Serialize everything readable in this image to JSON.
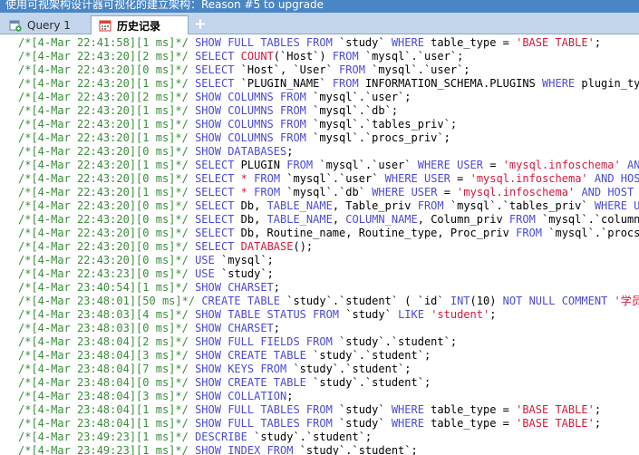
{
  "window": {
    "title": "使用可视架构设计器可视化的建立架构：Reason #5 to upgrade"
  },
  "tabs": [
    {
      "label": "Query 1",
      "active": false
    },
    {
      "label": "历史记录",
      "active": true
    }
  ],
  "add_tab_label": "+",
  "colors": {
    "comment": "#3a8d3a",
    "keyword": "#4b4bd6",
    "string": "#d5193a",
    "tabbar": "#c2d5ea",
    "titlebar": "#4a86c5"
  },
  "history": [
    [
      [
        "c",
        "/*[4-Mar 22:41:58][1 ms]*/"
      ],
      [
        "t",
        " "
      ],
      [
        "k",
        "SHOW FULL TABLES FROM"
      ],
      [
        "t",
        " `study` "
      ],
      [
        "k",
        "WHERE"
      ],
      [
        "t",
        " table_type = "
      ],
      [
        "s",
        "'BASE TABLE'"
      ],
      [
        "t",
        ";"
      ]
    ],
    [
      [
        "c",
        "/*[4-Mar 22:43:20][2 ms]*/"
      ],
      [
        "t",
        " "
      ],
      [
        "k",
        "SELECT"
      ],
      [
        "t",
        " "
      ],
      [
        "f",
        "COUNT"
      ],
      [
        "t",
        "(`Host`) "
      ],
      [
        "k",
        "FROM"
      ],
      [
        "t",
        " `mysql`.`user`;"
      ]
    ],
    [
      [
        "c",
        "/*[4-Mar 22:43:20][0 ms]*/"
      ],
      [
        "t",
        " "
      ],
      [
        "k",
        "SELECT"
      ],
      [
        "t",
        " `Host`, `User` "
      ],
      [
        "k",
        "FROM"
      ],
      [
        "t",
        " `mysql`.`user`;"
      ]
    ],
    [
      [
        "c",
        "/*[4-Mar 22:43:20][1 ms]*/"
      ],
      [
        "t",
        " "
      ],
      [
        "k",
        "SELECT"
      ],
      [
        "t",
        " `PLUGIN_NAME` "
      ],
      [
        "k",
        "FROM"
      ],
      [
        "t",
        " INFORMATION_SCHEMA.PLUGINS "
      ],
      [
        "k",
        "WHERE"
      ],
      [
        "t",
        " plugin_type="
      ]
    ],
    [
      [
        "c",
        "/*[4-Mar 22:43:20][2 ms]*/"
      ],
      [
        "t",
        " "
      ],
      [
        "k",
        "SHOW COLUMNS FROM"
      ],
      [
        "t",
        " `mysql`.`user`;"
      ]
    ],
    [
      [
        "c",
        "/*[4-Mar 22:43:20][1 ms]*/"
      ],
      [
        "t",
        " "
      ],
      [
        "k",
        "SHOW COLUMNS FROM"
      ],
      [
        "t",
        " `mysql`.`db`;"
      ]
    ],
    [
      [
        "c",
        "/*[4-Mar 22:43:20][1 ms]*/"
      ],
      [
        "t",
        " "
      ],
      [
        "k",
        "SHOW COLUMNS FROM"
      ],
      [
        "t",
        " `mysql`.`tables_priv`;"
      ]
    ],
    [
      [
        "c",
        "/*[4-Mar 22:43:20][1 ms]*/"
      ],
      [
        "t",
        " "
      ],
      [
        "k",
        "SHOW COLUMNS FROM"
      ],
      [
        "t",
        " `mysql`.`procs_priv`;"
      ]
    ],
    [
      [
        "c",
        "/*[4-Mar 22:43:20][0 ms]*/"
      ],
      [
        "t",
        " "
      ],
      [
        "k",
        "SHOW DATABASES"
      ],
      [
        "t",
        ";"
      ]
    ],
    [
      [
        "c",
        "/*[4-Mar 22:43:20][1 ms]*/"
      ],
      [
        "t",
        " "
      ],
      [
        "k",
        "SELECT"
      ],
      [
        "t",
        " PLUGIN "
      ],
      [
        "k",
        "FROM"
      ],
      [
        "t",
        " `mysql`.`user` "
      ],
      [
        "k",
        "WHERE"
      ],
      [
        "t",
        " "
      ],
      [
        "k",
        "USER"
      ],
      [
        "t",
        " = "
      ],
      [
        "s",
        "'mysql.infoschema'"
      ],
      [
        "t",
        " "
      ],
      [
        "k",
        "AND H"
      ]
    ],
    [
      [
        "c",
        "/*[4-Mar 22:43:20][0 ms]*/"
      ],
      [
        "t",
        " "
      ],
      [
        "k",
        "SELECT"
      ],
      [
        "t",
        " "
      ],
      [
        "s",
        "*"
      ],
      [
        "t",
        " "
      ],
      [
        "k",
        "FROM"
      ],
      [
        "t",
        " `mysql`.`user` "
      ],
      [
        "k",
        "WHERE"
      ],
      [
        "t",
        " "
      ],
      [
        "k",
        "USER"
      ],
      [
        "t",
        " = "
      ],
      [
        "s",
        "'mysql.infoschema'"
      ],
      [
        "t",
        " "
      ],
      [
        "k",
        "AND HOST"
      ],
      [
        "t",
        " ="
      ]
    ],
    [
      [
        "c",
        "/*[4-Mar 22:43:20][1 ms]*/"
      ],
      [
        "t",
        " "
      ],
      [
        "k",
        "SELECT"
      ],
      [
        "t",
        " "
      ],
      [
        "s",
        "*"
      ],
      [
        "t",
        " "
      ],
      [
        "k",
        "FROM"
      ],
      [
        "t",
        " `mysql`.`db` "
      ],
      [
        "k",
        "WHERE"
      ],
      [
        "t",
        " "
      ],
      [
        "k",
        "USER"
      ],
      [
        "t",
        " = "
      ],
      [
        "s",
        "'mysql.infoschema'"
      ],
      [
        "t",
        " "
      ],
      [
        "k",
        "AND HOST"
      ],
      [
        "t",
        " = "
      ],
      [
        "s",
        "'"
      ]
    ],
    [
      [
        "c",
        "/*[4-Mar 22:43:20][0 ms]*/"
      ],
      [
        "t",
        " "
      ],
      [
        "k",
        "SELECT"
      ],
      [
        "t",
        " Db, "
      ],
      [
        "k",
        "TABLE_NAME"
      ],
      [
        "t",
        ", Table_priv "
      ],
      [
        "k",
        "FROM"
      ],
      [
        "t",
        " `mysql`.`tables_priv` "
      ],
      [
        "k",
        "WHERE USER"
      ]
    ],
    [
      [
        "c",
        "/*[4-Mar 22:43:20][0 ms]*/"
      ],
      [
        "t",
        " "
      ],
      [
        "k",
        "SELECT"
      ],
      [
        "t",
        " Db, "
      ],
      [
        "k",
        "TABLE_NAME"
      ],
      [
        "t",
        ", "
      ],
      [
        "k",
        "COLUMN_NAME"
      ],
      [
        "t",
        ", Column_priv "
      ],
      [
        "k",
        "FROM"
      ],
      [
        "t",
        " `mysql`.`columns_p"
      ]
    ],
    [
      [
        "c",
        "/*[4-Mar 22:43:20][0 ms]*/"
      ],
      [
        "t",
        " "
      ],
      [
        "k",
        "SELECT"
      ],
      [
        "t",
        " Db, Routine_name, Routine_type, Proc_priv "
      ],
      [
        "k",
        "FROM"
      ],
      [
        "t",
        " `mysql`.`procs_p"
      ]
    ],
    [
      [
        "c",
        "/*[4-Mar 22:43:20][0 ms]*/"
      ],
      [
        "t",
        " "
      ],
      [
        "k",
        "SELECT"
      ],
      [
        "t",
        " "
      ],
      [
        "f",
        "DATABASE"
      ],
      [
        "t",
        "();"
      ]
    ],
    [
      [
        "c",
        "/*[4-Mar 22:43:20][0 ms]*/"
      ],
      [
        "t",
        " "
      ],
      [
        "k",
        "USE"
      ],
      [
        "t",
        " `mysql`;"
      ]
    ],
    [
      [
        "c",
        "/*[4-Mar 22:43:23][0 ms]*/"
      ],
      [
        "t",
        " "
      ],
      [
        "k",
        "USE"
      ],
      [
        "t",
        " `study`;"
      ]
    ],
    [
      [
        "c",
        "/*[4-Mar 23:40:54][1 ms]*/"
      ],
      [
        "t",
        " "
      ],
      [
        "k",
        "SHOW CHARSET"
      ],
      [
        "t",
        ";"
      ]
    ],
    [
      [
        "c",
        "/*[4-Mar 23:48:01][50 ms]*/"
      ],
      [
        "t",
        " "
      ],
      [
        "k",
        "CREATE TABLE"
      ],
      [
        "t",
        " `study`.`student` ( `id` "
      ],
      [
        "k",
        "INT"
      ],
      [
        "t",
        "(10) "
      ],
      [
        "k",
        "NOT NULL COMMENT"
      ],
      [
        "t",
        " "
      ],
      [
        "s",
        "'学员id"
      ]
    ],
    [
      [
        "c",
        "/*[4-Mar 23:48:03][4 ms]*/"
      ],
      [
        "t",
        " "
      ],
      [
        "k",
        "SHOW TABLE STATUS FROM"
      ],
      [
        "t",
        " `study` "
      ],
      [
        "k",
        "LIKE"
      ],
      [
        "t",
        " "
      ],
      [
        "s",
        "'student'"
      ],
      [
        "t",
        ";"
      ]
    ],
    [
      [
        "c",
        "/*[4-Mar 23:48:03][0 ms]*/"
      ],
      [
        "t",
        " "
      ],
      [
        "k",
        "SHOW CHARSET"
      ],
      [
        "t",
        ";"
      ]
    ],
    [
      [
        "c",
        "/*[4-Mar 23:48:04][2 ms]*/"
      ],
      [
        "t",
        " "
      ],
      [
        "k",
        "SHOW FULL FIELDS FROM"
      ],
      [
        "t",
        " `study`.`student`;"
      ]
    ],
    [
      [
        "c",
        "/*[4-Mar 23:48:04][3 ms]*/"
      ],
      [
        "t",
        " "
      ],
      [
        "k",
        "SHOW CREATE TABLE"
      ],
      [
        "t",
        " `study`.`student`;"
      ]
    ],
    [
      [
        "c",
        "/*[4-Mar 23:48:04][7 ms]*/"
      ],
      [
        "t",
        " "
      ],
      [
        "k",
        "SHOW KEYS FROM"
      ],
      [
        "t",
        " `study`.`student`;"
      ]
    ],
    [
      [
        "c",
        "/*[4-Mar 23:48:04][0 ms]*/"
      ],
      [
        "t",
        " "
      ],
      [
        "k",
        "SHOW CREATE TABLE"
      ],
      [
        "t",
        " `study`.`student`;"
      ]
    ],
    [
      [
        "c",
        "/*[4-Mar 23:48:04][3 ms]*/"
      ],
      [
        "t",
        " "
      ],
      [
        "k",
        "SHOW COLLATION"
      ],
      [
        "t",
        ";"
      ]
    ],
    [
      [
        "c",
        "/*[4-Mar 23:48:04][1 ms]*/"
      ],
      [
        "t",
        " "
      ],
      [
        "k",
        "SHOW FULL TABLES FROM"
      ],
      [
        "t",
        " `study` "
      ],
      [
        "k",
        "WHERE"
      ],
      [
        "t",
        " table_type = "
      ],
      [
        "s",
        "'BASE TABLE'"
      ],
      [
        "t",
        ";"
      ]
    ],
    [
      [
        "c",
        "/*[4-Mar 23:48:04][1 ms]*/"
      ],
      [
        "t",
        " "
      ],
      [
        "k",
        "SHOW FULL TABLES FROM"
      ],
      [
        "t",
        " `study` "
      ],
      [
        "k",
        "WHERE"
      ],
      [
        "t",
        " table_type = "
      ],
      [
        "s",
        "'BASE TABLE'"
      ],
      [
        "t",
        ";"
      ]
    ],
    [
      [
        "c",
        "/*[4-Mar 23:49:23][1 ms]*/"
      ],
      [
        "t",
        " "
      ],
      [
        "k",
        "DESCRIBE"
      ],
      [
        "t",
        " `study`.`student`;"
      ]
    ],
    [
      [
        "c",
        "/*[4-Mar 23:49:23][1 ms]*/"
      ],
      [
        "t",
        " "
      ],
      [
        "k",
        "SHOW INDEX FROM"
      ],
      [
        "t",
        " `study`.`student`;"
      ]
    ]
  ]
}
